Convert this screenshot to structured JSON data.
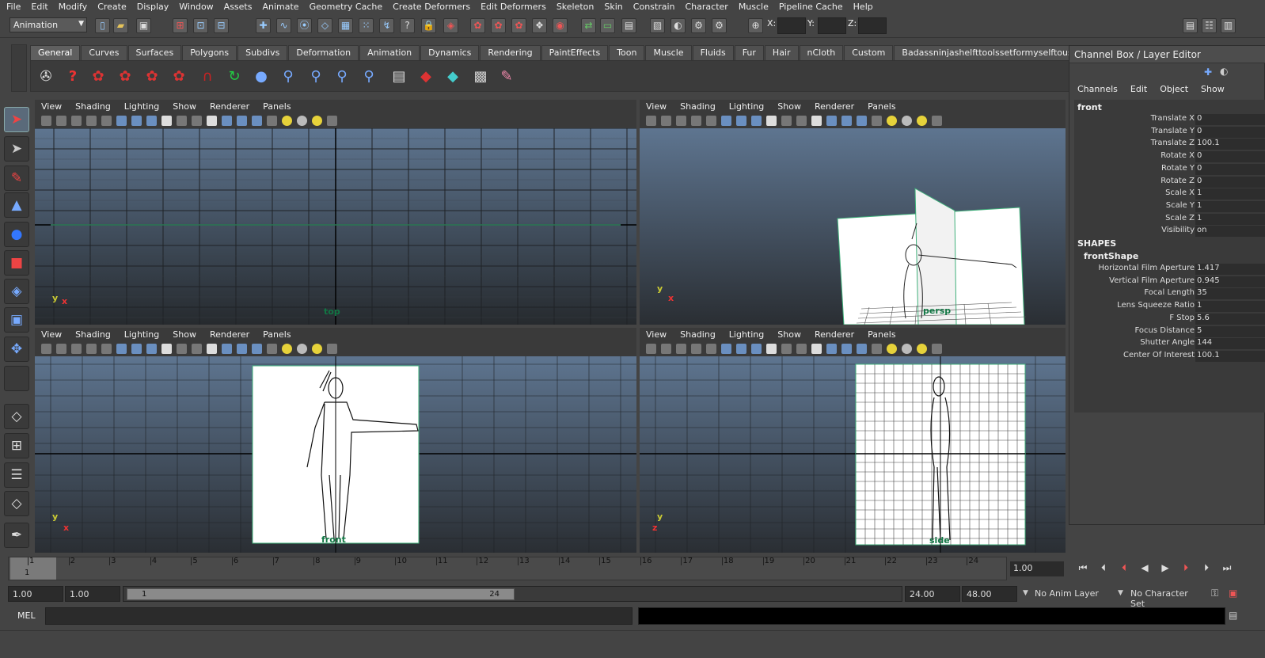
{
  "menu": [
    "File",
    "Edit",
    "Modify",
    "Create",
    "Display",
    "Window",
    "Assets",
    "Animate",
    "Geometry Cache",
    "Create Deformers",
    "Edit Deformers",
    "Skeleton",
    "Skin",
    "Constrain",
    "Character",
    "Muscle",
    "Pipeline Cache",
    "Help"
  ],
  "status": {
    "mode": "Animation",
    "x_label": "X:",
    "y_label": "Y:",
    "z_label": "Z:"
  },
  "shelf": {
    "tabs": [
      "General",
      "Curves",
      "Surfaces",
      "Polygons",
      "Subdivs",
      "Deformation",
      "Animation",
      "Dynamics",
      "Rendering",
      "PaintEffects",
      "Toon",
      "Muscle",
      "Fluids",
      "Fur",
      "Hair",
      "nCloth",
      "Custom",
      "Badassninjashelfttoolssetformyselftouse"
    ],
    "active_tab": "General"
  },
  "panel_menu": [
    "View",
    "Shading",
    "Lighting",
    "Show",
    "Renderer",
    "Panels"
  ],
  "viewports": {
    "top": {
      "label": "top"
    },
    "persp": {
      "label": "persp"
    },
    "front": {
      "label": "front"
    },
    "side": {
      "label": "side"
    }
  },
  "axis": {
    "x": "x",
    "y": "y",
    "z": "z"
  },
  "channel_box": {
    "title": "Channel Box / Layer Editor",
    "menu": [
      "Channels",
      "Edit",
      "Object",
      "Show"
    ],
    "object": "front",
    "channels": [
      {
        "name": "Translate X",
        "value": "0"
      },
      {
        "name": "Translate Y",
        "value": "0"
      },
      {
        "name": "Translate Z",
        "value": "100.1"
      },
      {
        "name": "Rotate X",
        "value": "0"
      },
      {
        "name": "Rotate Y",
        "value": "0"
      },
      {
        "name": "Rotate Z",
        "value": "0"
      },
      {
        "name": "Scale X",
        "value": "1"
      },
      {
        "name": "Scale Y",
        "value": "1"
      },
      {
        "name": "Scale Z",
        "value": "1"
      },
      {
        "name": "Visibility",
        "value": "on"
      }
    ],
    "shapes_header": "SHAPES",
    "shape_name": "frontShape",
    "shape_attrs": [
      {
        "name": "Horizontal Film Aperture",
        "value": "1.417"
      },
      {
        "name": "Vertical Film Aperture",
        "value": "0.945"
      },
      {
        "name": "Focal Length",
        "value": "35"
      },
      {
        "name": "Lens Squeeze Ratio",
        "value": "1"
      },
      {
        "name": "F Stop",
        "value": "5.6"
      },
      {
        "name": "Focus Distance",
        "value": "5"
      },
      {
        "name": "Shutter Angle",
        "value": "144"
      },
      {
        "name": "Center Of Interest",
        "value": "100.1"
      }
    ]
  },
  "timeline": {
    "ticks": [
      "1",
      "2",
      "3",
      "4",
      "5",
      "6",
      "7",
      "8",
      "9",
      "10",
      "11",
      "12",
      "13",
      "14",
      "15",
      "16",
      "17",
      "18",
      "19",
      "20",
      "21",
      "22",
      "23",
      "24"
    ],
    "current_marker": "1",
    "current_frame": "1.00"
  },
  "range": {
    "start": "1.00",
    "playback_start": "1.00",
    "slider_start": "1",
    "slider_end": "24",
    "playback_end": "24.00",
    "end": "48.00",
    "anim_layer": "No Anim Layer",
    "character_set": "No Character Set"
  },
  "command": {
    "label": "MEL"
  }
}
